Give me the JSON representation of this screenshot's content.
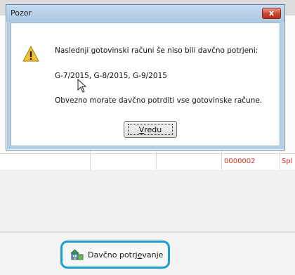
{
  "dialog": {
    "title": "Pozor",
    "close_label": "x",
    "icon": "warning-icon",
    "message_line1": "Naslednji gotovinski računi še niso bili davčno potrjeni:",
    "message_line2": "G-7/2015, G-8/2015, G-9/2015",
    "message_line3": "Obvezno morate davčno potrditi vse gotovinske račune.",
    "ok_accel": "V",
    "ok_rest": "redu"
  },
  "table_row": {
    "code": "0000002",
    "partial": "Spl"
  },
  "toolbar": {
    "action_label_a": "Davčno potr",
    "action_label_accel": "je",
    "action_label_b": "vanje",
    "action_icon": "building-icon",
    "highlight_color": "#1a9ad6"
  }
}
